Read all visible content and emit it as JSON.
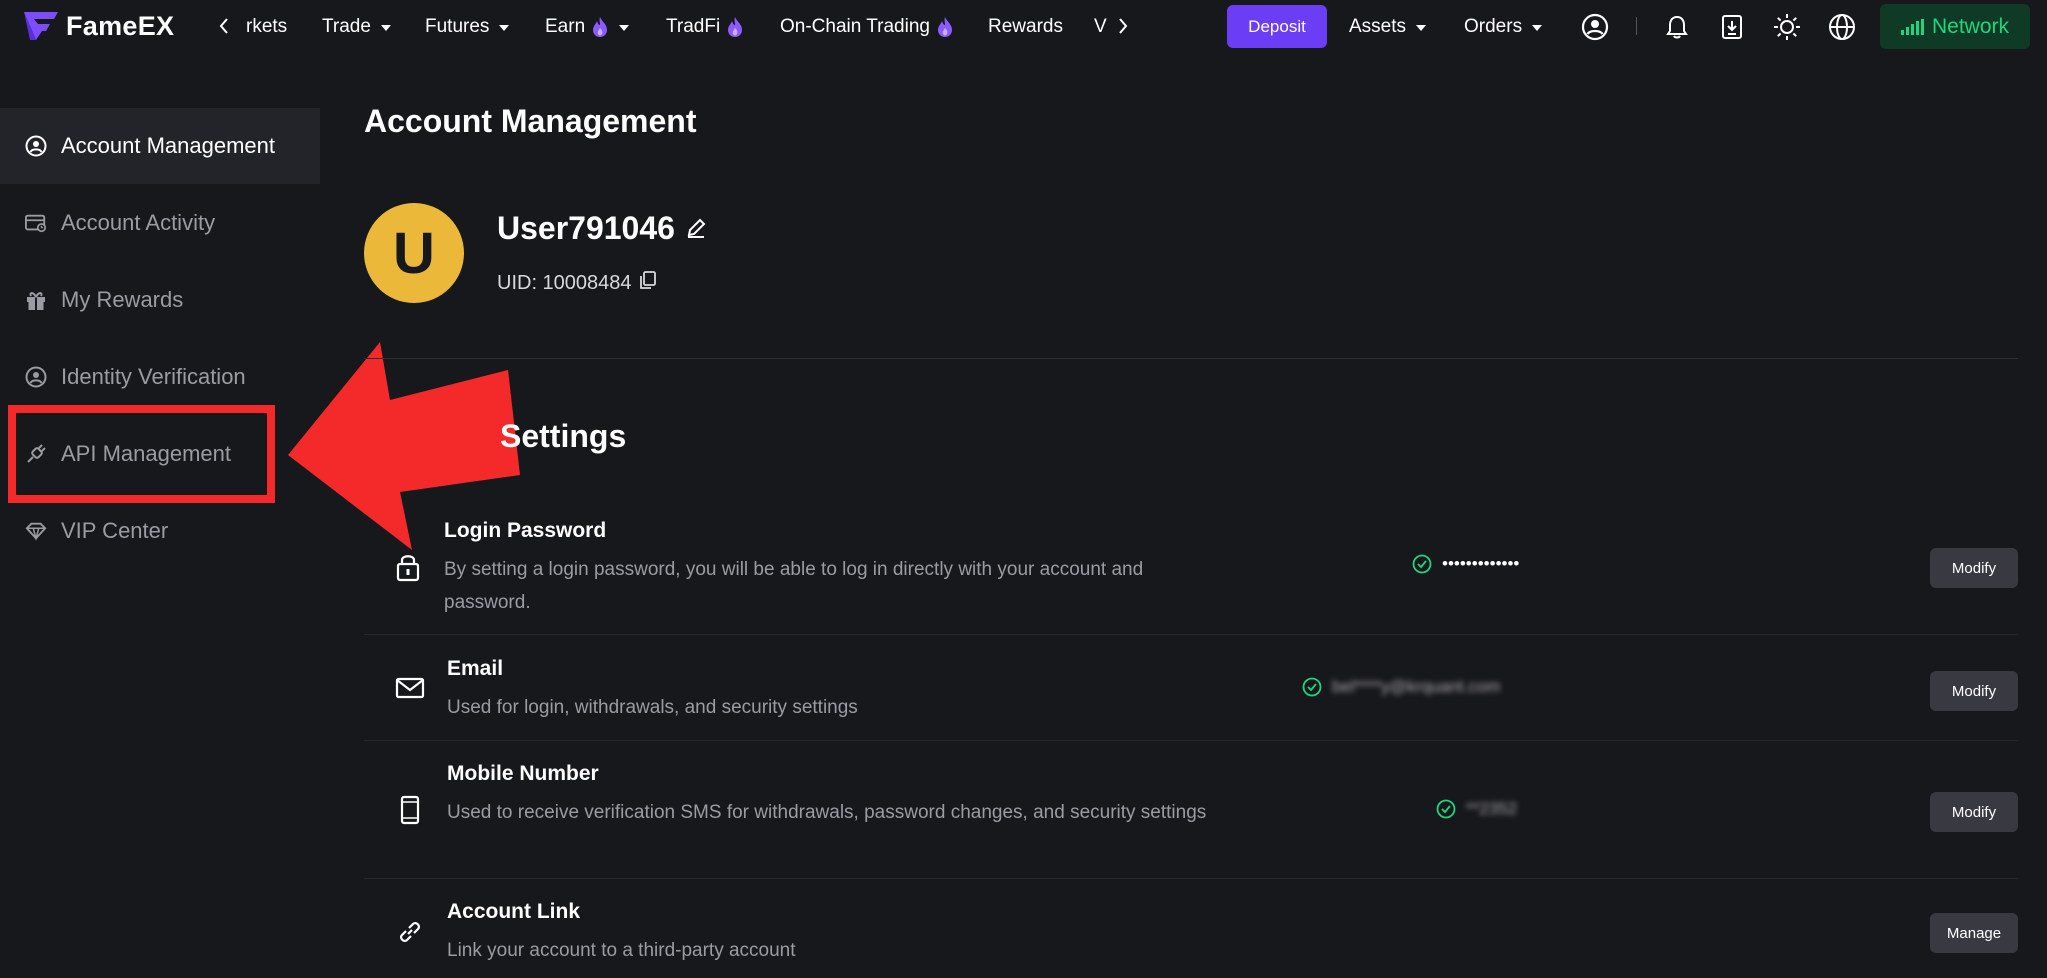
{
  "brand": {
    "name": "FameEX"
  },
  "topnav": {
    "items": [
      {
        "label": "rkets"
      },
      {
        "label": "Trade"
      },
      {
        "label": "Futures"
      },
      {
        "label": "Earn"
      },
      {
        "label": "TradFi"
      },
      {
        "label": "On-Chain Trading"
      },
      {
        "label": "Rewards"
      },
      {
        "label": "V"
      }
    ],
    "deposit_label": "Deposit",
    "assets_label": "Assets",
    "orders_label": "Orders",
    "network_label": "Network",
    "icons": [
      "profile-icon",
      "bell-icon",
      "download-icon",
      "sun-icon",
      "globe-icon"
    ]
  },
  "sidebar": {
    "items": [
      {
        "label": "Account Management",
        "icon": "user-circle-icon"
      },
      {
        "label": "Account Activity",
        "icon": "activity-card-icon"
      },
      {
        "label": "My Rewards",
        "icon": "gift-icon"
      },
      {
        "label": "Identity Verification",
        "icon": "id-user-icon"
      },
      {
        "label": "API Management",
        "icon": "api-plug-icon"
      },
      {
        "label": "VIP Center",
        "icon": "diamond-icon"
      }
    ]
  },
  "profile": {
    "page_title": "Account Management",
    "avatar_letter": "U",
    "username": "User791046",
    "uid": "UID: 10008484"
  },
  "security": {
    "section_title": "Settings",
    "rows": [
      {
        "title": "Login Password",
        "description": "By setting a login password, you will be able to log in directly with your account and password.",
        "status": "•••••••••••••",
        "button": "Modify"
      },
      {
        "title": "Email",
        "description": "Used for login, withdrawals, and security settings",
        "status": "bel****y@krquant.com",
        "button": "Modify"
      },
      {
        "title": "Mobile Number",
        "description": "Used to receive verification SMS for withdrawals, password changes, and security settings",
        "status": "**2352",
        "button": "Modify"
      },
      {
        "title": "Account Link",
        "description": "Link your account to a third-party account",
        "status": "",
        "button": "Manage"
      }
    ]
  },
  "colors": {
    "background": "#17181c",
    "accent": "#6b3ef6",
    "network": "#1fd67c",
    "avatar": "#ebb839",
    "highlight": "#f42a2a"
  }
}
